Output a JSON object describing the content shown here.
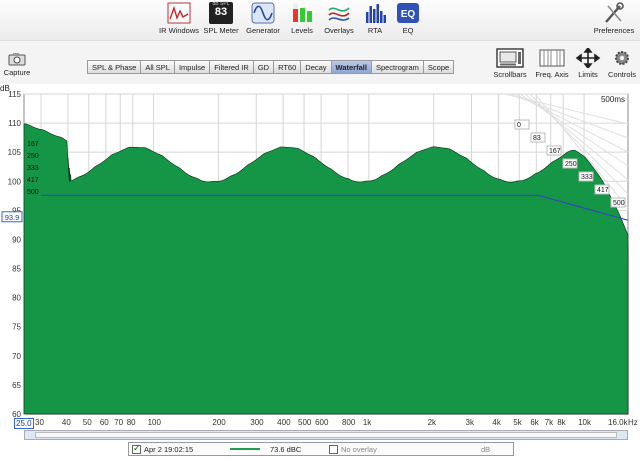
{
  "toolbar": {
    "items": [
      {
        "label": "IR Windows",
        "icon": "ir-windows-icon"
      },
      {
        "label": "SPL Meter",
        "icon": "spl-meter-icon",
        "badge_top": "dB SPL",
        "badge_value": "83"
      },
      {
        "label": "Generator",
        "icon": "generator-icon"
      },
      {
        "label": "Levels",
        "icon": "levels-icon"
      },
      {
        "label": "Overlays",
        "icon": "overlays-icon"
      },
      {
        "label": "RTA",
        "icon": "rta-icon"
      },
      {
        "label": "EQ",
        "icon": "eq-icon"
      }
    ],
    "preferences": "Preferences"
  },
  "capture": "Capture",
  "tabs": [
    "SPL & Phase",
    "All SPL",
    "Impulse",
    "Filtered IR",
    "GD",
    "RT60",
    "Decay",
    "Waterfall",
    "Spectrogram",
    "Scope"
  ],
  "active_tab": "Waterfall",
  "right_buttons": [
    "Scrollbars",
    "Freq. Axis",
    "Limits",
    "Controls"
  ],
  "plot": {
    "y_unit": "dB",
    "y_ticks": [
      "115",
      "110",
      "105",
      "100",
      "95",
      "90",
      "85",
      "80",
      "75",
      "70",
      "65",
      "60"
    ],
    "y_marker": "93.9",
    "x_ticks": [
      "25.0",
      "30",
      "40",
      "50",
      "60",
      "70",
      "80",
      "100",
      "200",
      "300",
      "400",
      "500",
      "600",
      "800",
      "1k",
      "2k",
      "3k",
      "4k",
      "5k",
      "6k",
      "7k",
      "8k",
      "10k",
      "16.0k",
      "Hz"
    ],
    "time_label": "500ms",
    "left_slice_labels": [
      "167",
      "250",
      "333",
      "417",
      "500"
    ],
    "right_slice_labels": [
      "0",
      "83",
      "167",
      "250",
      "333",
      "417",
      "500"
    ]
  },
  "chart_data": {
    "type": "area",
    "title": "",
    "xlabel": "Hz",
    "ylabel": "dB",
    "ylim": [
      60,
      115
    ],
    "xlim_hz": [
      25,
      16000
    ],
    "x_scale": "log",
    "slices_ms": [
      0,
      83,
      167,
      250,
      333,
      417,
      500
    ],
    "grid": true,
    "fill_color": "#1f9e4f"
  },
  "legend": {
    "checked": true,
    "measurement": "Apr 2 19:02:15",
    "level": "73.6 dBC",
    "overlay": "No overlay",
    "unit": "dB"
  }
}
